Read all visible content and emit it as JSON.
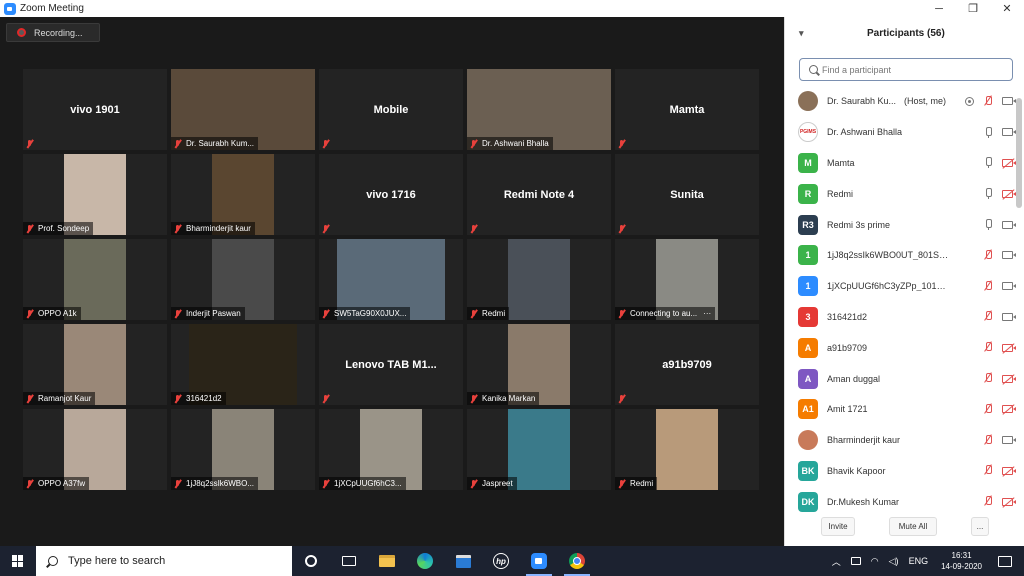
{
  "window": {
    "title": "Zoom Meeting",
    "minimize": "─",
    "restore": "❐",
    "close": "✕"
  },
  "recording": {
    "label": "Recording..."
  },
  "tiles": [
    {
      "name": "vivo 1901",
      "has_video": false
    },
    {
      "name": "Dr. Saurabh Kum...",
      "has_video": true,
      "video_color": "#5a4a3a",
      "wide": true
    },
    {
      "name": "Mobile",
      "has_video": false
    },
    {
      "name": "Dr. Ashwani Bhalla",
      "has_video": true,
      "video_color": "#6b5f52",
      "wide": true,
      "active": true
    },
    {
      "name": "Mamta",
      "has_video": false
    },
    {
      "name": "Prof. Sondeep",
      "has_video": true,
      "video_color": "#c8b7a8"
    },
    {
      "name": "Bharminderjit kaur",
      "has_video": true,
      "video_color": "#5a4630"
    },
    {
      "name": "vivo 1716",
      "has_video": false
    },
    {
      "name": "Redmi Note 4",
      "has_video": false
    },
    {
      "name": "Sunita",
      "has_video": false
    },
    {
      "name": "OPPO A1k",
      "has_video": true,
      "video_color": "#6a6a5a"
    },
    {
      "name": "Inderjit Paswan",
      "has_video": true,
      "video_color": "#4a4a4a"
    },
    {
      "name": "SW5TaG90X0JUX...",
      "has_video": true,
      "video_color": "#5a6a78",
      "mid": true
    },
    {
      "name": "Redmi",
      "has_video": true,
      "video_color": "#4a5058"
    },
    {
      "name": "Connecting to au...",
      "has_video": true,
      "video_color": "#8a8a84",
      "extra": "···"
    },
    {
      "name": "Ramanjot Kaur",
      "has_video": true,
      "video_color": "#9a8878"
    },
    {
      "name": "316421d2",
      "has_video": true,
      "video_color": "#2a2418",
      "mid": true
    },
    {
      "name": "Lenovo TAB M1...",
      "has_video": false
    },
    {
      "name": "Kanika Markan",
      "has_video": true,
      "video_color": "#8a7a6a"
    },
    {
      "name": "a91b9709",
      "has_video": false
    },
    {
      "name": "OPPO A37fw",
      "has_video": true,
      "video_color": "#b8a89a"
    },
    {
      "name": "1jJ8q2ssIk6WBO...",
      "has_video": true,
      "video_color": "#8a8478"
    },
    {
      "name": "1jXCpUUGf6hC3...",
      "has_video": true,
      "video_color": "#9a9488"
    },
    {
      "name": "Jaspreet",
      "has_video": true,
      "video_color": "#3a7a8a"
    },
    {
      "name": "Redmi",
      "has_video": true,
      "video_color": "#b89a7a"
    }
  ],
  "panel": {
    "title": "Participants (56)",
    "search_placeholder": "Find a participant",
    "participants": [
      {
        "avatar": "",
        "avatar_kind": "photo",
        "avatar_color": "#8a7058",
        "name": "Dr. Saurabh Ku...",
        "note": "(Host, me)",
        "mic": "off",
        "cam": "on",
        "recording": true
      },
      {
        "avatar": "PGIMS",
        "avatar_kind": "logo",
        "avatar_color": "#ffffff",
        "name": "Dr. Ashwani Bhalla",
        "mic": "on",
        "cam": "on"
      },
      {
        "avatar": "M",
        "avatar_color": "#3bb34a",
        "name": "Mamta",
        "mic": "on",
        "cam": "off"
      },
      {
        "avatar": "R",
        "avatar_color": "#3bb34a",
        "name": "Redmi",
        "mic": "on",
        "cam": "off"
      },
      {
        "avatar": "R3",
        "avatar_color": "#2c3e50",
        "name": "Redmi 3s prime",
        "mic": "on",
        "cam": "on"
      },
      {
        "avatar": "1",
        "avatar_color": "#3bb34a",
        "name": "1jJ8q2ssIk6WBO0UT_801SwKgr...",
        "mic": "off",
        "cam": "on"
      },
      {
        "avatar": "1",
        "avatar_color": "#2d8cff",
        "name": "1jXCpUUGf6hC3yZPp_101SAAA...",
        "mic": "off",
        "cam": "on"
      },
      {
        "avatar": "3",
        "avatar_color": "#e53935",
        "name": "316421d2",
        "mic": "off",
        "cam": "on"
      },
      {
        "avatar": "A",
        "avatar_color": "#f57c00",
        "name": "a91b9709",
        "mic": "off",
        "cam": "off"
      },
      {
        "avatar": "A",
        "avatar_color": "#7e57c2",
        "name": "Aman duggal",
        "mic": "off",
        "cam": "off"
      },
      {
        "avatar": "A1",
        "avatar_color": "#f57c00",
        "name": "Amit 1721",
        "mic": "off",
        "cam": "off"
      },
      {
        "avatar": "",
        "avatar_kind": "photo",
        "avatar_color": "#c87a5a",
        "name": "Bharminderjit kaur",
        "mic": "off",
        "cam": "on"
      },
      {
        "avatar": "BK",
        "avatar_color": "#26a69a",
        "name": "Bhavik Kapoor",
        "mic": "off",
        "cam": "off"
      },
      {
        "avatar": "DK",
        "avatar_color": "#26a69a",
        "name": "Dr.Mukesh Kumar",
        "mic": "off",
        "cam": "off"
      }
    ],
    "invite_label": "Invite",
    "mute_all_label": "Mute All",
    "more_label": "..."
  },
  "taskbar": {
    "search_placeholder": "Type here to search",
    "hp_label": "hp",
    "tray_chevron": "︿",
    "language": "ENG",
    "time": "16:31",
    "date": "14-09-2020"
  }
}
